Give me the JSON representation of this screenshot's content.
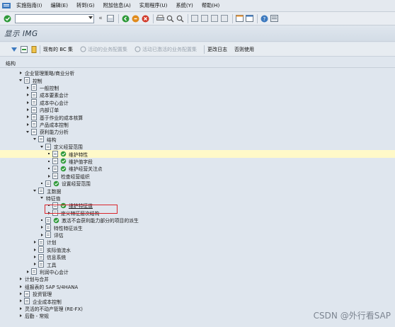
{
  "menubar": {
    "items": [
      "实施指南(I)",
      "编辑(E)",
      "转到(G)",
      "附加信息(A)",
      "实用程序(U)",
      "系统(Y)",
      "帮助(H)"
    ]
  },
  "toolbar": {
    "command_value": ""
  },
  "title": "显示 IMG",
  "app_toolbar": {
    "existing_bc_sets": "现有的 BC 集",
    "active_bc_sets": "活动的业务配置集",
    "activated_bc_sets": "活动已激活的业务配置集",
    "change_log": "更改日志",
    "not_used": "否则使用"
  },
  "tree": {
    "header": "结构",
    "rows": [
      {
        "label": "企业管理策略/商业分析",
        "level": 1,
        "exp": "right",
        "doc": false,
        "exec": false
      },
      {
        "label": "控制",
        "level": 1,
        "exp": "down",
        "doc": true,
        "exec": false
      },
      {
        "label": "一般控制",
        "level": 2,
        "exp": "right",
        "doc": true,
        "exec": false
      },
      {
        "label": "成本要素会计",
        "level": 2,
        "exp": "right",
        "doc": true,
        "exec": false
      },
      {
        "label": "成本中心会计",
        "level": 2,
        "exp": "right",
        "doc": true,
        "exec": false
      },
      {
        "label": "内部订单",
        "level": 2,
        "exp": "right",
        "doc": true,
        "exec": false
      },
      {
        "label": "基于作业的成本核算",
        "level": 2,
        "exp": "right",
        "doc": true,
        "exec": false
      },
      {
        "label": "产品成本控制",
        "level": 2,
        "exp": "right",
        "doc": true,
        "exec": false
      },
      {
        "label": "获利能力分析",
        "level": 2,
        "exp": "down",
        "doc": true,
        "exec": false
      },
      {
        "label": "结构",
        "level": 3,
        "exp": "down",
        "doc": true,
        "exec": false
      },
      {
        "label": "定义经营范围",
        "level": 4,
        "exp": "down",
        "doc": true,
        "exec": false
      },
      {
        "label": "维护特性",
        "level": 5,
        "exp": "dot",
        "doc": true,
        "exec": true,
        "highlight": true
      },
      {
        "label": "维护值字段",
        "level": 5,
        "exp": "dot",
        "doc": true,
        "exec": true
      },
      {
        "label": "维护经营关注点",
        "level": 5,
        "exp": "dot",
        "doc": true,
        "exec": true
      },
      {
        "label": "检查经营组织",
        "level": 5,
        "exp": "right",
        "doc": true,
        "exec": false
      },
      {
        "label": "设置经营范围",
        "level": 4,
        "exp": "dot",
        "doc": true,
        "exec": true
      },
      {
        "label": "主数据",
        "level": 3,
        "exp": "down",
        "doc": true,
        "exec": false
      },
      {
        "label": "特征值",
        "level": 4,
        "exp": "down",
        "doc": false,
        "exec": false
      },
      {
        "label": "维护特征值",
        "level": 5,
        "exp": "dot",
        "doc": true,
        "exec": true,
        "boxed": true
      },
      {
        "label": "定义特征层次结构",
        "level": 5,
        "exp": "right",
        "doc": true,
        "exec": false
      },
      {
        "label": "激活不会获利能力部分的项目的派生",
        "level": 4,
        "exp": "dot",
        "doc": true,
        "exec": true
      },
      {
        "label": "特性特征派生",
        "level": 4,
        "exp": "right",
        "doc": true,
        "exec": false
      },
      {
        "label": "评估",
        "level": 4,
        "exp": "right",
        "doc": true,
        "exec": false
      },
      {
        "label": "计划",
        "level": 3,
        "exp": "right",
        "doc": true,
        "exec": false
      },
      {
        "label": "实际值流水",
        "level": 3,
        "exp": "right",
        "doc": true,
        "exec": false
      },
      {
        "label": "信息系统",
        "level": 3,
        "exp": "right",
        "doc": true,
        "exec": false
      },
      {
        "label": "工具",
        "level": 3,
        "exp": "right",
        "doc": true,
        "exec": false
      },
      {
        "label": "利润中心会计",
        "level": 2,
        "exp": "right",
        "doc": true,
        "exec": false
      },
      {
        "label": "计划与合并",
        "level": 1,
        "exp": "right",
        "doc": false,
        "exec": false
      },
      {
        "label": "组报表的 SAP S/4HANA",
        "level": 1,
        "exp": "right",
        "doc": false,
        "exec": false
      },
      {
        "label": "投资管理",
        "level": 1,
        "exp": "right",
        "doc": true,
        "exec": false
      },
      {
        "label": "企业成本控制",
        "level": 1,
        "exp": "right",
        "doc": true,
        "exec": false
      },
      {
        "label": "灵活的不动产管理 (RE-FX)",
        "level": 1,
        "exp": "right",
        "doc": false,
        "exec": false
      },
      {
        "label": "后勤 - 常规",
        "level": 1,
        "exp": "right",
        "doc": false,
        "exec": false
      }
    ]
  },
  "watermark": "CSDN @外行看SAP",
  "colors": {
    "highlight": "#fff9c8",
    "red_box": "#d9262c",
    "exec_green": "#2f9a3a"
  }
}
